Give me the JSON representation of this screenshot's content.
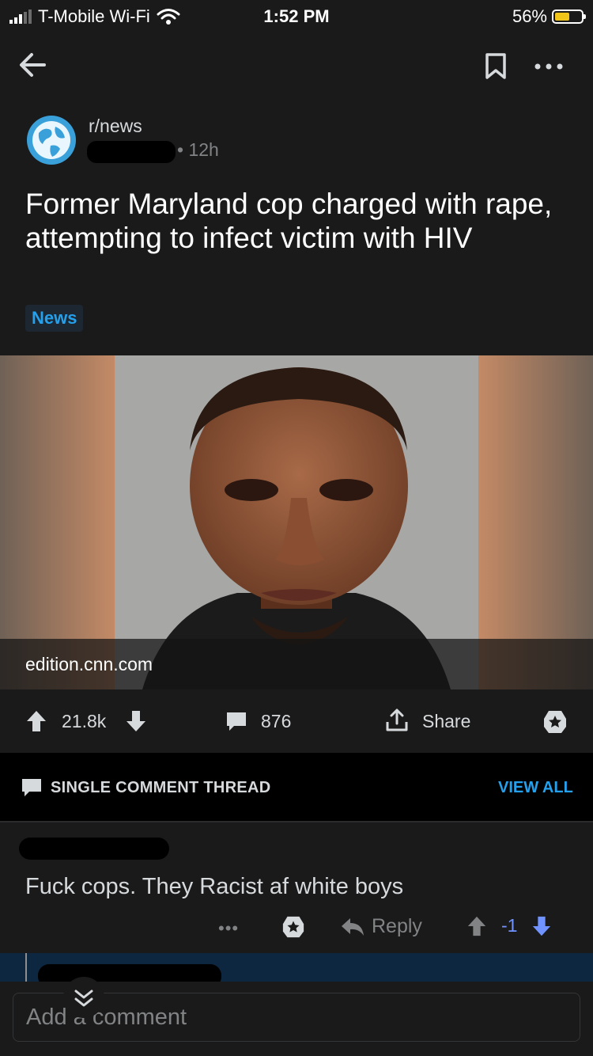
{
  "status_bar": {
    "carrier": "T-Mobile Wi-Fi",
    "time": "1:52 PM",
    "battery": "56%",
    "battery_level": 0.56
  },
  "header": {
    "back_icon": "arrow-left-icon",
    "bookmark_icon": "bookmark-icon",
    "more_icon": "ellipsis-icon"
  },
  "post": {
    "subreddit": "r/news",
    "age": "• 12h",
    "title": "Former Maryland cop charged with rape, attempting to infect victim with HIV",
    "flair": "News",
    "domain": "edition.cnn.com",
    "upvotes": "21.8k",
    "comments": "876",
    "share_label": "Share"
  },
  "thread": {
    "label": "SINGLE COMMENT THREAD",
    "view_all": "VIEW ALL"
  },
  "comment": {
    "text": "Fuck cops. They Racist af white boys",
    "more": "•••",
    "reply_label": "Reply",
    "score": "-1"
  },
  "composer": {
    "placeholder": "Add a comment"
  },
  "colors": {
    "background": "#1a1a1b",
    "accent_blue": "#24a0ed",
    "downvote_blue": "#7193ff",
    "text": "#d7dadc",
    "muted": "#818384"
  }
}
